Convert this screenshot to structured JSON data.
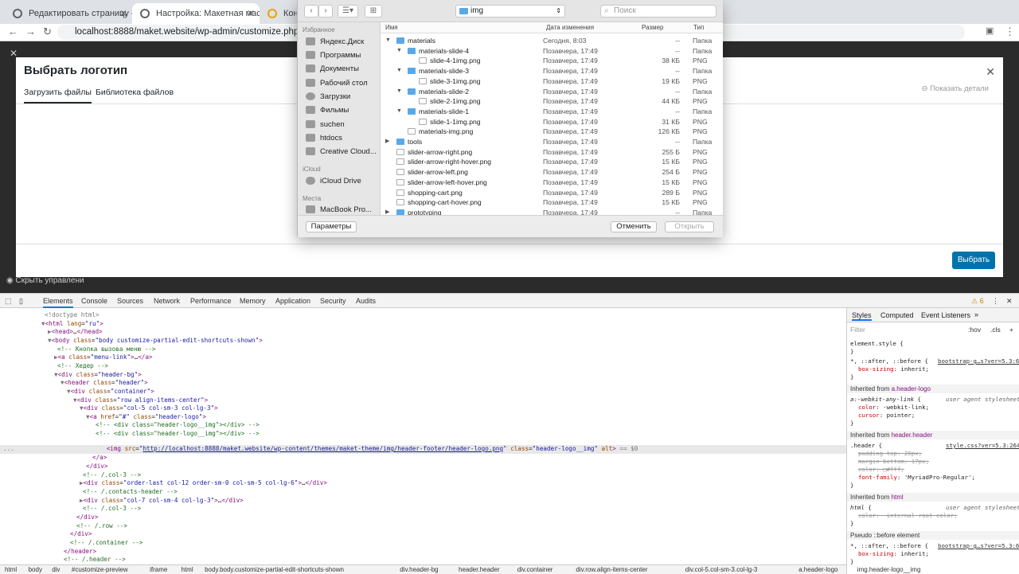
{
  "browser": {
    "tabs": [
      {
        "label": "Редактировать страницу ‹ Ма"
      },
      {
        "label": "Настройка: Макетная мастер"
      },
      {
        "label": "Конст"
      }
    ],
    "url": "localhost:8888/maket.website/wp-admin/customize.php?url=htt"
  },
  "modal": {
    "title": "Выбрать логотип",
    "tab_upload": "Загрузить файлы",
    "tab_library": "Библиотека файлов",
    "show_details": "Показать детали",
    "choose_button": "Выбрать",
    "hide_controls": "Скрыть управлени"
  },
  "finder": {
    "path": "img",
    "search_placeholder": "Поиск",
    "favorites_header": "Избранное",
    "favorites": [
      "Яндекс.Диск",
      "Программы",
      "Документы",
      "Рабочий стол",
      "Загрузки",
      "Фильмы",
      "suchen",
      "htdocs",
      "Creative Cloud..."
    ],
    "icloud_header": "iCloud",
    "icloud": [
      "iCloud Drive"
    ],
    "places_header": "Места",
    "places": [
      "MacBook Pro..."
    ],
    "columns": {
      "name": "Имя",
      "date": "Дата изменения",
      "size": "Размер",
      "kind": "Тип"
    },
    "rows": [
      {
        "name": "materials",
        "date": "Сегодня, 8:03",
        "size": "--",
        "kind": "Папка"
      },
      {
        "name": "materials-slide-4",
        "date": "Позавчера, 17:49",
        "size": "--",
        "kind": "Папка"
      },
      {
        "name": "slide-4-1img.png",
        "date": "Позавчера, 17:49",
        "size": "38 КБ",
        "kind": "PNG"
      },
      {
        "name": "materials-slide-3",
        "date": "Позавчера, 17:49",
        "size": "--",
        "kind": "Папка"
      },
      {
        "name": "slide-3-1img.png",
        "date": "Позавчера, 17:49",
        "size": "19 КБ",
        "kind": "PNG"
      },
      {
        "name": "materials-slide-2",
        "date": "Позавчера, 17:49",
        "size": "--",
        "kind": "Папка"
      },
      {
        "name": "slide-2-1img.png",
        "date": "Позавчера, 17:49",
        "size": "44 КБ",
        "kind": "PNG"
      },
      {
        "name": "materials-slide-1",
        "date": "Позавчера, 17:49",
        "size": "--",
        "kind": "Папка"
      },
      {
        "name": "slide-1-1img.png",
        "date": "Позавчера, 17:49",
        "size": "31 КБ",
        "kind": "PNG"
      },
      {
        "name": "materials-img.png",
        "date": "Позавчера, 17:49",
        "size": "126 КБ",
        "kind": "PNG"
      },
      {
        "name": "tools",
        "date": "Позавчера, 17:49",
        "size": "--",
        "kind": "Папка"
      },
      {
        "name": "slider-arrow-right.png",
        "date": "Позавчера, 17:49",
        "size": "255 Б",
        "kind": "PNG"
      },
      {
        "name": "slider-arrow-right-hover.png",
        "date": "Позавчера, 17:49",
        "size": "15 КБ",
        "kind": "PNG"
      },
      {
        "name": "slider-arrow-left.png",
        "date": "Позавчера, 17:49",
        "size": "254 Б",
        "kind": "PNG"
      },
      {
        "name": "slider-arrow-left-hover.png",
        "date": "Позавчера, 17:49",
        "size": "15 КБ",
        "kind": "PNG"
      },
      {
        "name": "shopping-cart.png",
        "date": "Позавчера, 17:49",
        "size": "289 Б",
        "kind": "PNG"
      },
      {
        "name": "shopping-cart-hover.png",
        "date": "Позавчера, 17:49",
        "size": "15 КБ",
        "kind": "PNG"
      },
      {
        "name": "prototyping",
        "date": "Позавчера, 17:49",
        "size": "--",
        "kind": "Папка"
      }
    ],
    "params_button": "Параметры",
    "cancel_button": "Отменить",
    "open_button": "Открыть"
  },
  "devtools": {
    "tabs": [
      "Elements",
      "Console",
      "Sources",
      "Network",
      "Performance",
      "Memory",
      "Application",
      "Security",
      "Audits"
    ],
    "warnings": "6",
    "breadcrumbs": [
      "html",
      "body",
      "div",
      "#customize-preview",
      "iframe",
      "html",
      "body.body.customize-partial-edit-shortcuts-shown",
      "div.header-bg",
      "header.header",
      "div.container",
      "div.row.align-items-center",
      "div.col-5.col-sm-3.col-lg-3",
      "a.header-logo",
      "img.header-logo__img"
    ],
    "styles_tabs": [
      "Styles",
      "Computed",
      "Event Listeners"
    ],
    "filter_placeholder": "Filter",
    "hov": ":hov",
    "cls": ".cls"
  }
}
